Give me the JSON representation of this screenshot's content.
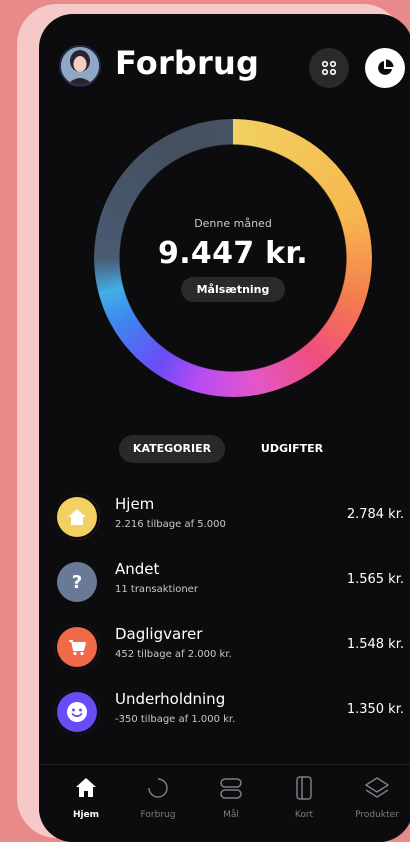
{
  "header": {
    "title": "Forbrug"
  },
  "summary": {
    "caption": "Denne måned",
    "amount": "9.447 kr.",
    "goal_label": "Målsætning"
  },
  "tabs": {
    "categories": "KATEGORIER",
    "expenses": "UDGIFTER"
  },
  "categories": [
    {
      "icon": "home-icon",
      "title": "Hjem",
      "subtitle": "2.216 tilbage af 5.000",
      "amount": "2.784 kr.",
      "color": "#f2d062"
    },
    {
      "icon": "question-icon",
      "title": "Andet",
      "subtitle": "11 transaktioner",
      "amount": "1.565 kr.",
      "color": "#6a7a96"
    },
    {
      "icon": "cart-icon",
      "title": "Dagligvarer",
      "subtitle": "452 tilbage af 2.000 kr.",
      "amount": "1.548 kr.",
      "color": "#f06a4a"
    },
    {
      "icon": "smiley-icon",
      "title": "Underholdning",
      "subtitle": "-350 tilbage af 1.000 kr.",
      "amount": "1.350 kr.",
      "color": "#6a4cf7"
    }
  ],
  "nav": {
    "home": "Hjem",
    "spending": "Forbrug",
    "goals": "Mål",
    "card": "Kort",
    "products": "Produkter"
  }
}
